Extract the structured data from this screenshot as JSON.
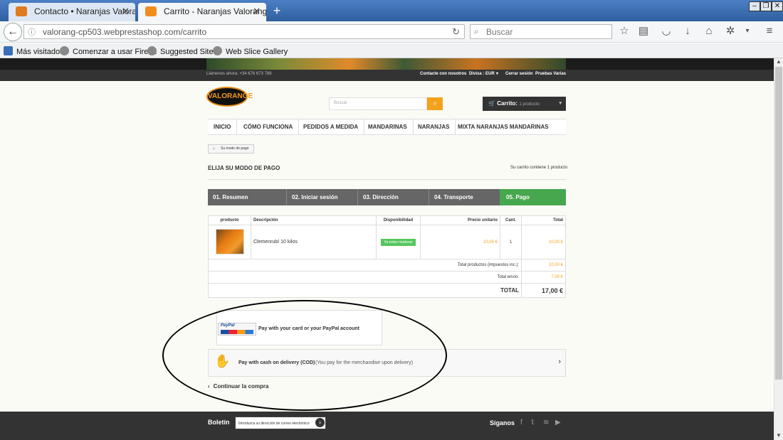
{
  "browser": {
    "tabs": [
      {
        "title": "Contacto • Naranjas Valoran..."
      },
      {
        "title": "Carrito - Naranjas Valorange. ..."
      }
    ],
    "new_tab": "+",
    "url": "valorang-cp503.webprestashop.com/carrito",
    "search_placeholder": "Buscar",
    "bookmarks": [
      "Más visitados",
      "Comenzar a usar Firef...",
      "Suggested Sites",
      "Web Slice Gallery"
    ]
  },
  "topbar": {
    "phone": "Llámenos ahora: +34 676 673 788",
    "links": [
      "Contacte con nosotros",
      "Divisa : EUR",
      "Cerrar sesión",
      "Pruebas Varias"
    ]
  },
  "shop": {
    "logo": "VALORANGE",
    "search_placeholder": "Buscar",
    "cart_label": "Carrito:",
    "cart_count": "1 producto"
  },
  "menu": [
    "INICIO",
    "CÓMO FUNCIONA",
    "PEDIDOS A MEDIDA",
    "MANDARINAS",
    "NARANJAS",
    "MIXTA NARANJAS MANDARINAS"
  ],
  "breadcrumb": "Su modo de pago",
  "heading": "ELIJA SU MODO DE PAGO",
  "cart_summary": "Su carrito contiene 1 producto",
  "steps": [
    "01. Resumen",
    "02. Iniciar sesión",
    "03. Dirección",
    "04. Transporte",
    "05. Pago"
  ],
  "table": {
    "headers": [
      "producto",
      "Descripción",
      "Disponibilidad",
      "Precio unitario",
      "Cant.",
      "Total"
    ],
    "row": {
      "description": "Clemenrubí 10 kilos",
      "availability": "Ya estan maduras",
      "unit_price": "10,00 €",
      "qty": "1",
      "total": "10,00 €"
    },
    "total_products_label": "Total productos (impuestos inc.):",
    "total_products": "10,00 €",
    "shipping_label": "Total envío:",
    "shipping": "7,00 €",
    "total_label": "TOTAL",
    "total": "17,00 €"
  },
  "payment": {
    "paypal_logo": "PayPal",
    "paypal_text": "Pay with your card or your PayPal account",
    "cod_text": "Pay with cash on delivery (COD)",
    "cod_note": "(You pay for the merchandise upon delivery)"
  },
  "continue": "Continuar la compra",
  "footer": {
    "newsletter": "Boletín",
    "newsletter_placeholder": "Introduzca su dirección de correo electrónico",
    "follow": "Síganos"
  },
  "colors": {
    "accent": "#f4a21b",
    "step_active": "#46a74e",
    "step_inactive": "#666666"
  }
}
